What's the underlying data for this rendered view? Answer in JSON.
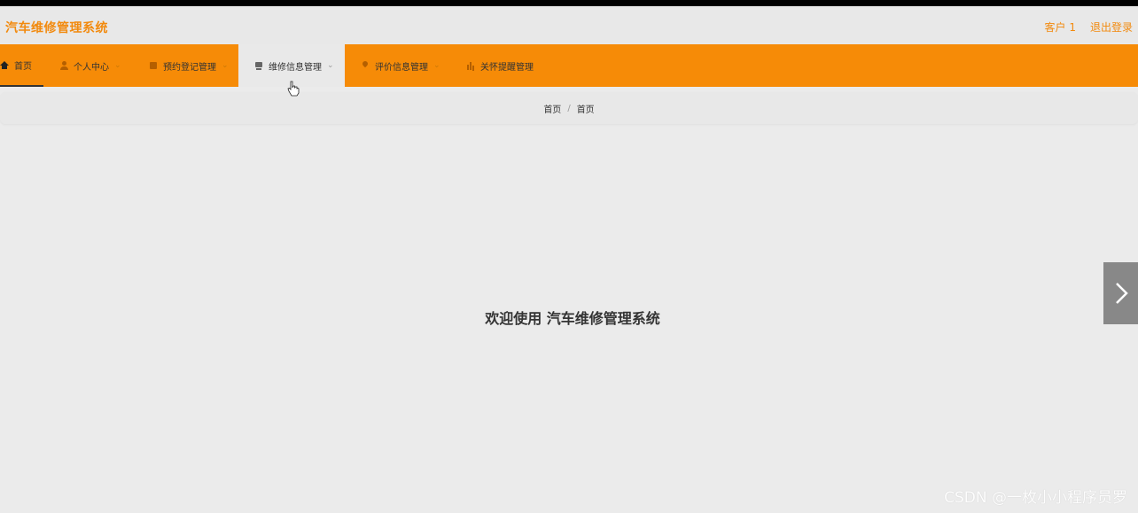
{
  "app": {
    "title": "汽车维修管理系统"
  },
  "header": {
    "user_label": "客户 1",
    "logout_label": "退出登录"
  },
  "nav": {
    "items": [
      {
        "label": "首页",
        "icon": "home-icon",
        "has_dropdown": false
      },
      {
        "label": "个人中心",
        "icon": "user-icon",
        "has_dropdown": true
      },
      {
        "label": "预约登记管理",
        "icon": "calendar-icon",
        "has_dropdown": true
      },
      {
        "label": "维修信息管理",
        "icon": "repair-icon",
        "has_dropdown": true
      },
      {
        "label": "评价信息管理",
        "icon": "pin-icon",
        "has_dropdown": true
      },
      {
        "label": "关怀提醒管理",
        "icon": "bar-chart-icon",
        "has_dropdown": false
      }
    ]
  },
  "breadcrumb": {
    "items": [
      "首页",
      "首页"
    ],
    "separator": "/"
  },
  "main": {
    "welcome": "欢迎使用 汽车维修管理系统"
  },
  "watermark": "CSDN @一枚小小程序员罗",
  "colors": {
    "accent": "#f68b07",
    "title": "#f28a0e",
    "background": "#ebebeb"
  }
}
